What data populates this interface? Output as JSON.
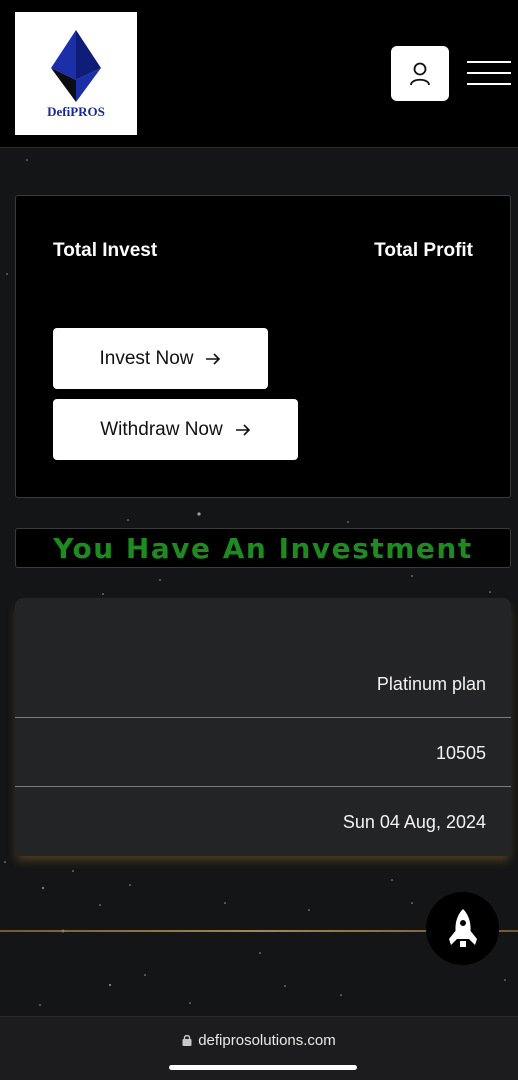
{
  "header": {
    "logo_text": "DefiPROS"
  },
  "stats": {
    "total_invest_label": "Total Invest",
    "total_profit_label": "Total Profit"
  },
  "actions": {
    "invest_label": "Invest Now",
    "withdraw_label": "Withdraw Now"
  },
  "banner": {
    "text": "You Have An Investment"
  },
  "investment": {
    "plan": "Platinum plan",
    "amount": "10505",
    "date": "Sun 04 Aug, 2024"
  },
  "browser": {
    "url": "defiprosolutions.com"
  },
  "icons": {
    "logo": "ethereum-diamond-icon",
    "user": "user-icon",
    "menu": "hamburger-menu-icon",
    "arrow": "arrow-right-icon",
    "rocket": "rocket-icon",
    "lock": "lock-icon"
  },
  "colors": {
    "banner_text": "#1f8a1f",
    "logo_blue": "#1a2a8c",
    "accent_gold": "#c9a25f"
  }
}
